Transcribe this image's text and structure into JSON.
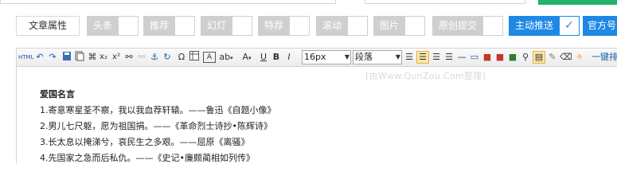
{
  "attributes": {
    "button_label": "文章属性",
    "tags": [
      {
        "label": "头条"
      },
      {
        "label": "推荐"
      },
      {
        "label": "幻灯"
      },
      {
        "label": "特荐"
      },
      {
        "label": "滚动"
      },
      {
        "label": "图片"
      },
      {
        "label": "原创提交"
      }
    ],
    "active_tag": {
      "label": "主动推送",
      "check": "✓"
    },
    "extra_label": "官方号"
  },
  "toolbar": {
    "html_label": "HTML",
    "font_size": "16px",
    "paragraph": "段落",
    "one_key_label": "一键排"
  },
  "editor": {
    "watermark": "[由Www.QunZou.Com整理]",
    "title": "爱国名言",
    "lines": [
      "1.寄意寒星荃不察，我以我血荐轩辕。——鲁迅《自题小像》",
      "2.男儿七尺躯，愿为祖国捐。——《革命烈士诗抄•陈辉诗》",
      "3.长太息以掩涕兮，哀民生之多艰。——屈原《离骚》",
      "4.先国家之急而后私仇。——《史记•廉颇蔺相如列传》"
    ]
  },
  "colors": {
    "accent": "#1e88e5",
    "green": "#1fb36b",
    "tag_gray": "#cfcfcf"
  }
}
